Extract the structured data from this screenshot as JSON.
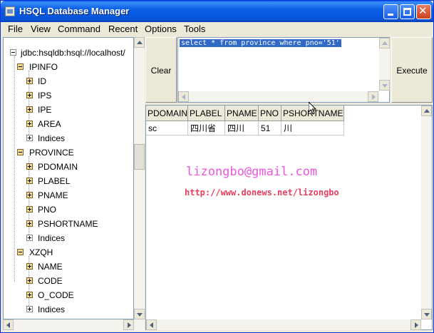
{
  "window": {
    "title": "HSQL Database Manager"
  },
  "menubar": {
    "items": [
      "File",
      "View",
      "Command",
      "Recent",
      "Options",
      "Tools"
    ]
  },
  "tree": {
    "root": "jdbc:hsqldb:hsql://localhost/",
    "tables": [
      {
        "name": "IPINFO",
        "columns": [
          "ID",
          "IPS",
          "IPE",
          "AREA",
          "Indices"
        ]
      },
      {
        "name": "PROVINCE",
        "columns": [
          "PDOMAIN",
          "PLABEL",
          "PNAME",
          "PNO",
          "PSHORTNAME",
          "Indices"
        ]
      },
      {
        "name": "XZQH",
        "columns": [
          "NAME",
          "CODE",
          "O_CODE",
          "Indices"
        ]
      }
    ]
  },
  "toolbar": {
    "clear_label": "Clear",
    "execute_label": "Execute"
  },
  "sql_editor": {
    "value": "select * from province where pno='51'"
  },
  "results": {
    "headers": [
      "PDOMAIN",
      "PLABEL",
      "PNAME",
      "PNO",
      "PSHORTNAME"
    ],
    "rows": [
      [
        "sc",
        "四川省",
        "四川",
        "51",
        "川"
      ]
    ]
  },
  "watermark": {
    "email": "lizongbo@gmail.com",
    "url": "http://www.donews.net/lizongbo"
  },
  "icons": [
    "app-icon",
    "minimize-icon",
    "maximize-icon",
    "close-icon",
    "tree-expand-icon",
    "tree-collapse-icon"
  ]
}
